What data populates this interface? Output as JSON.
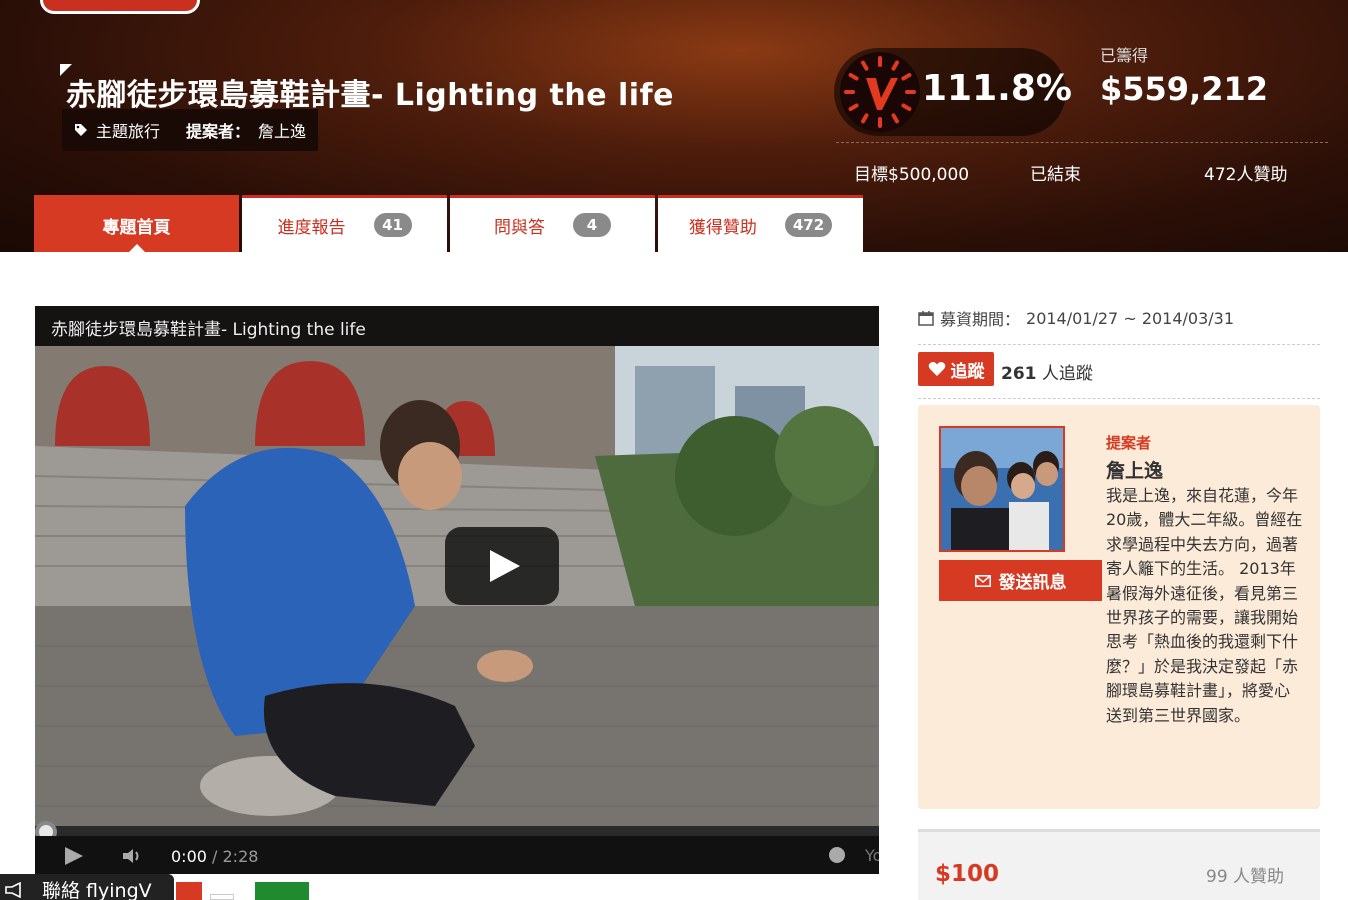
{
  "project": {
    "title": "赤腳徒步環島募鞋計畫- Lighting the life",
    "category": "主題旅行",
    "proposer_label": "提案者：",
    "proposer_name": "詹上逸"
  },
  "stats": {
    "percent": "111.8%",
    "percent_value": 111.8,
    "raised_label": "已籌得",
    "raised_value": "$559,212",
    "goal": "目標$500,000",
    "status": "已結束",
    "backers": "472人贊助"
  },
  "tabs": [
    {
      "label": "專題首頁",
      "count": null,
      "active": true
    },
    {
      "label": "進度報告",
      "count": "41",
      "active": false
    },
    {
      "label": "問與答",
      "count": "4",
      "active": false
    },
    {
      "label": "獲得贊助",
      "count": "472",
      "active": false
    }
  ],
  "video": {
    "title": "赤腳徒步環島募鞋計畫- Lighting the life",
    "current_time": "0:00",
    "duration": " / 2:28",
    "brand_text": "Yo",
    "progress": 0
  },
  "sidebar": {
    "period_label": "募資期間：",
    "period_value": "2014/01/27 ~ 2014/03/31",
    "follow_label": "追蹤",
    "follow_count": "261",
    "follow_suffix": " 人追蹤",
    "proposer_card": {
      "label": "提案者",
      "name": "詹上逸",
      "message_button": "發送訊息",
      "bio": "我是上逸，來自花蓮，今年20歲，體大二年級。曾經在求學過程中失去方向，過著寄人籬下的生活。 2013年暑假海外遠征後，看見第三世界孩子的需要，讓我開始思考「熱血後的我還剩下什麼？」於是我決定發起「赤腳環島募鞋計畫」，將愛心送到第三世界國家。"
    },
    "reward": {
      "amount": "$100",
      "backers": "99 人贊助"
    }
  },
  "contact_bar": {
    "label": "聯絡 flyingV"
  },
  "colors": {
    "accent": "#d63a22",
    "card_bg": "#fdebd9",
    "hero_dark": "#2a0f07"
  },
  "icons": [
    "tag-icon",
    "heart-icon",
    "calendar-icon",
    "mail-icon",
    "play-icon",
    "volume-icon",
    "clock-icon",
    "megaphone-icon"
  ]
}
